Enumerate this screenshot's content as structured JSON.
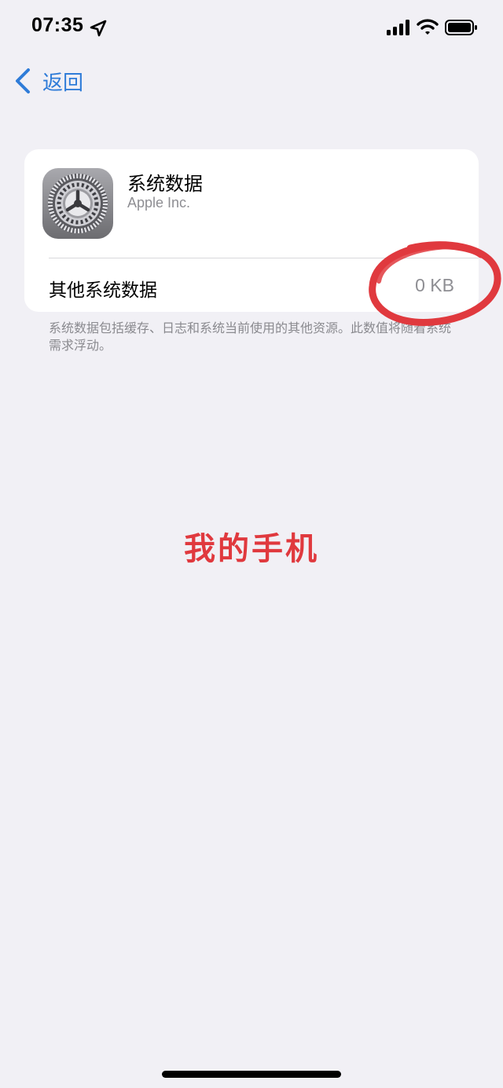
{
  "status_bar": {
    "time": "07:35",
    "icons": [
      "location-arrow-icon",
      "cellular-signal-icon",
      "wifi-icon",
      "battery-icon"
    ]
  },
  "nav": {
    "back_label": "返回",
    "accent_color": "#2f7cd8"
  },
  "app": {
    "name": "系统数据",
    "vendor": "Apple Inc.",
    "icon": "settings-gear-icon"
  },
  "row": {
    "label": "其他系统数据",
    "value": "0 KB"
  },
  "footnote": "系统数据包括缓存、日志和系统当前使用的其他资源。此数值将随着系统需求浮动。",
  "annotation": {
    "caption": "我的手机",
    "color": "#e0393e"
  }
}
